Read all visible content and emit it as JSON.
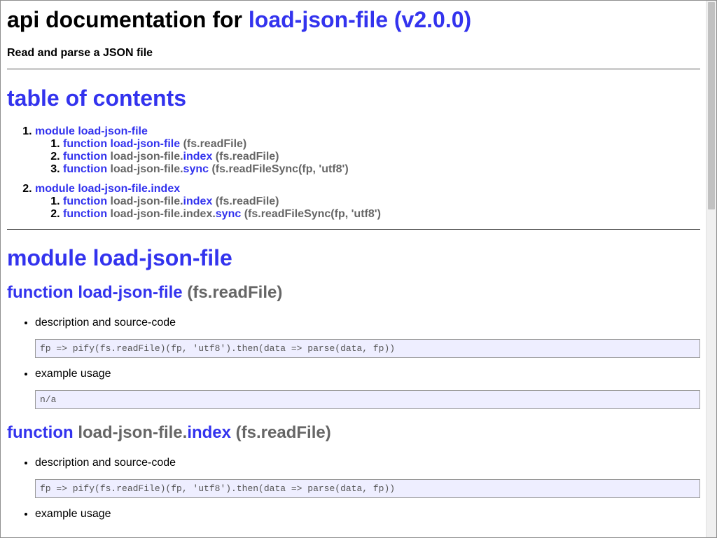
{
  "header": {
    "title_prefix": "api documentation for",
    "title_link": "load-json-file (v2.0.0)",
    "subtitle": "Read and parse a JSON file"
  },
  "toc": {
    "heading": "table of contents",
    "groups": [
      {
        "label": "module load-json-file",
        "items": [
          {
            "kw": "function",
            "name_plain": "",
            "name_link": "load-json-file",
            "sig": "(fs.readFile)"
          },
          {
            "kw": "function",
            "name_plain": "load-json-file.",
            "name_link": "index",
            "sig": "(fs.readFile)"
          },
          {
            "kw": "function",
            "name_plain": "load-json-file.",
            "name_link": "sync",
            "sig": "(fs.readFileSync(fp, 'utf8')"
          }
        ]
      },
      {
        "label": "module load-json-file.index",
        "items": [
          {
            "kw": "function",
            "name_plain": "load-json-file.",
            "name_link": "index",
            "sig": "(fs.readFile)"
          },
          {
            "kw": "function",
            "name_plain": "load-json-file.index.",
            "name_link": "sync",
            "sig": "(fs.readFileSync(fp, 'utf8')"
          }
        ]
      }
    ]
  },
  "module": {
    "heading": "module load-json-file",
    "functions": [
      {
        "kw": "function",
        "name_plain": "",
        "name_link": "load-json-file",
        "sig": "(fs.readFile)",
        "desc_label": "description and source-code",
        "code": "fp => pify(fs.readFile)(fp, 'utf8').then(data => parse(data, fp))",
        "example_label": "example usage",
        "example": "n/a"
      },
      {
        "kw": "function",
        "name_plain": "load-json-file.",
        "name_link": "index",
        "sig": "(fs.readFile)",
        "desc_label": "description and source-code",
        "code": "fp => pify(fs.readFile)(fp, 'utf8').then(data => parse(data, fp))",
        "example_label": "example usage"
      }
    ]
  },
  "colors": {
    "link": "#3333ee",
    "muted": "#666666",
    "code_bg": "#eeeeff"
  }
}
